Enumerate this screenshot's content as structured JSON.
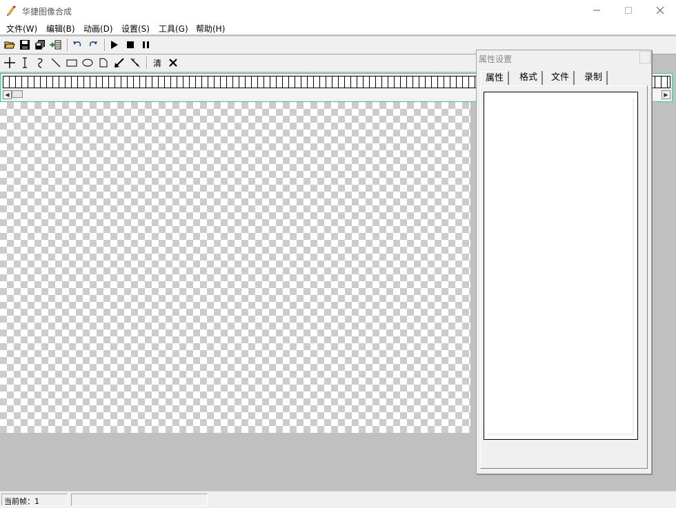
{
  "window": {
    "title": "华捷图像合成",
    "controls": [
      "minimize",
      "maximize",
      "close"
    ]
  },
  "menu": {
    "items": [
      "文件(W)",
      "编辑(B)",
      "动画(D)",
      "设置(S)",
      "工具(G)",
      "帮助(H)"
    ]
  },
  "toolbar1": {
    "icons": [
      "open-folder-icon",
      "save-icon",
      "save-all-icon",
      "import-icon",
      "undo-icon",
      "redo-icon",
      "play-icon",
      "stop-icon",
      "pause-icon"
    ]
  },
  "toolbar2": {
    "icons": [
      "crosshair-icon",
      "text-cursor-icon",
      "curve-icon",
      "line-icon",
      "rectangle-icon",
      "ellipse-icon",
      "polygon-icon",
      "arrow-icon",
      "pen-icon",
      "delete-icon"
    ],
    "clear_label": "清"
  },
  "properties_panel": {
    "title": "属性设置",
    "tabs": [
      "属性",
      "格式",
      "文件",
      "录制"
    ],
    "active_tab": "属性"
  },
  "statusbar": {
    "current_frame": "当前帧：1"
  },
  "colors": {
    "frame_strip_border": "#45c48a",
    "workspace_bg": "#c0c0c0"
  }
}
